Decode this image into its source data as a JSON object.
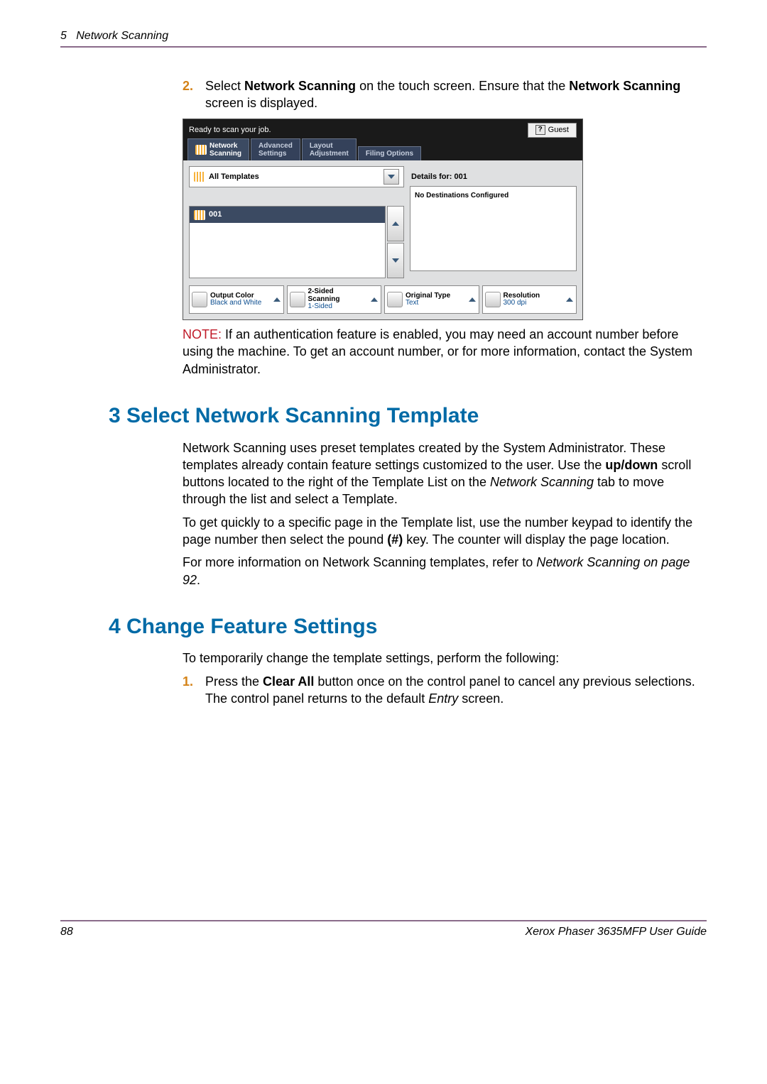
{
  "header": {
    "chapter_num": "5",
    "chapter_title": "Network Scanning"
  },
  "step2": {
    "num": "2.",
    "text_prefix": "Select ",
    "bold1": "Network Scanning",
    "mid": " on the touch screen. Ensure that the ",
    "bold2": "Network Scanning",
    "suffix": " screen is displayed."
  },
  "screenshot": {
    "status": "Ready to scan your job.",
    "guest": "Guest",
    "tabs": {
      "t1a": "Network",
      "t1b": "Scanning",
      "t2a": "Advanced",
      "t2b": "Settings",
      "t3a": "Layout",
      "t3b": "Adjustment",
      "t4": "Filing Options"
    },
    "all_templates": "All Templates",
    "details_label": "Details for:",
    "details_val": "001",
    "no_dest": "No Destinations Configured",
    "tmpl_item": "001",
    "options": {
      "output_color": {
        "label": "Output Color",
        "value": "Black and White"
      },
      "two_sided": {
        "label": "2-Sided Scanning",
        "value": "1-Sided"
      },
      "orig_type": {
        "label": "Original Type",
        "value": "Text"
      },
      "resolution": {
        "label": "Resolution",
        "value": "300 dpi"
      }
    }
  },
  "note": {
    "label": "NOTE:",
    "text": " If an authentication feature is enabled, you may need an account number before using the machine. To get an account number, or for more information, contact the System Administrator."
  },
  "sec3": {
    "heading": "3 Select Network Scanning Template",
    "p1_a": "Network Scanning uses preset templates created by the System Administrator. These templates already contain feature settings customized to the user. Use the ",
    "p1_bold": "up/down",
    "p1_b": " scroll buttons located to the right of the Template List on the ",
    "p1_italic": "Network Scanning",
    "p1_c": " tab to move through the list and select a Template.",
    "p2_a": "To get quickly to a specific page in the Template list, use the number keypad to identify the page number then select the pound ",
    "p2_bold": "(#)",
    "p2_b": " key. The counter will display the page location.",
    "p3_a": "For more information on Network Scanning templates, refer to ",
    "p3_italic": "Network Scanning on page 92",
    "p3_b": "."
  },
  "sec4": {
    "heading": "4 Change Feature Settings",
    "intro": "To temporarily change the template settings, perform the following:",
    "step1": {
      "num": "1.",
      "a": "Press the ",
      "bold": "Clear All",
      "b": " button once on the control panel to cancel any previous selections.  The control panel returns to the default ",
      "italic": "Entry",
      "c": " screen."
    }
  },
  "footer": {
    "page": "88",
    "doc": "Xerox Phaser 3635MFP User Guide"
  }
}
